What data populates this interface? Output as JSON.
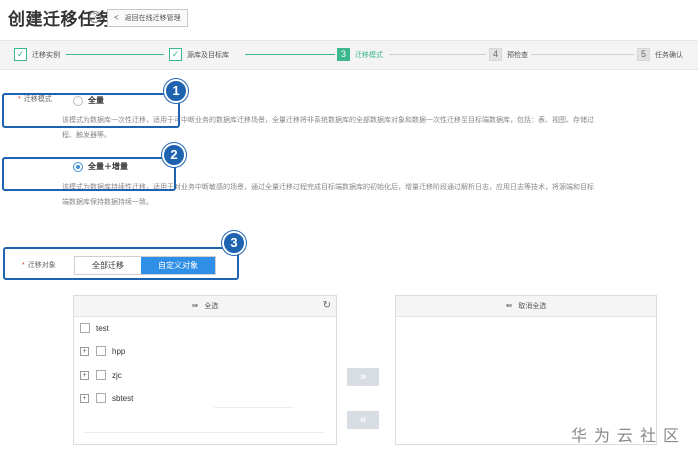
{
  "header": {
    "title": "创建迁移任务",
    "help_glyph": "?",
    "back_label": "返回在线迁移管理",
    "back_glyph": "<"
  },
  "steps": [
    {
      "num": "1",
      "label": "迁移实例",
      "state": "done",
      "glyph": "✓"
    },
    {
      "num": "2",
      "label": "源库及目标库",
      "state": "done",
      "glyph": "✓"
    },
    {
      "num": "3",
      "label": "迁移模式",
      "state": "active",
      "glyph": "3"
    },
    {
      "num": "4",
      "label": "预检查",
      "state": "todo",
      "glyph": "4"
    },
    {
      "num": "5",
      "label": "任务确认",
      "state": "todo",
      "glyph": "5"
    }
  ],
  "mode": {
    "label": "迁移模式",
    "options": [
      {
        "label": "全量",
        "checked": false,
        "desc": "该模式为数据库一次性迁移，适用于可中断业务的数据库迁移场景，全量迁移将非系统数据库的全部数据库对象和数据一次性迁移至目标端数据库，包括：表、视图、存储过程、触发器等。"
      },
      {
        "label": "全量＋增量",
        "checked": true,
        "desc": "该模式为数据库持续性迁移，适用于对业务中断敏感的场景，通过全量迁移过程完成目标端数据库的初始化后，增量迁移阶段通过解析日志，应用日志等技术，将源端和目标端数据库保持数据持续一致。"
      }
    ]
  },
  "object": {
    "label": "迁移对象",
    "segments": [
      {
        "label": "全部迁移",
        "active": false
      },
      {
        "label": "自定义对象",
        "active": true
      }
    ]
  },
  "transfer": {
    "left": {
      "title": "全选",
      "head_icon": "⇛",
      "refresh_glyph": "↻",
      "items": [
        {
          "name": "test",
          "expandable": false
        },
        {
          "name": "hpp",
          "expandable": true
        },
        {
          "name": "zjc",
          "expandable": true
        },
        {
          "name": "sbtest",
          "expandable": true
        }
      ]
    },
    "right": {
      "title": "取消全选",
      "head_icon": "⇚",
      "items": []
    },
    "move_right_glyph": "»",
    "move_left_glyph": "«",
    "expand_glyph": "+"
  },
  "callouts": [
    "1",
    "2",
    "3"
  ],
  "watermark": "华为云社区",
  "colors": {
    "accent_green": "#3db88e",
    "primary_blue": "#2f8ee6",
    "callout_blue": "#1e63b0"
  }
}
